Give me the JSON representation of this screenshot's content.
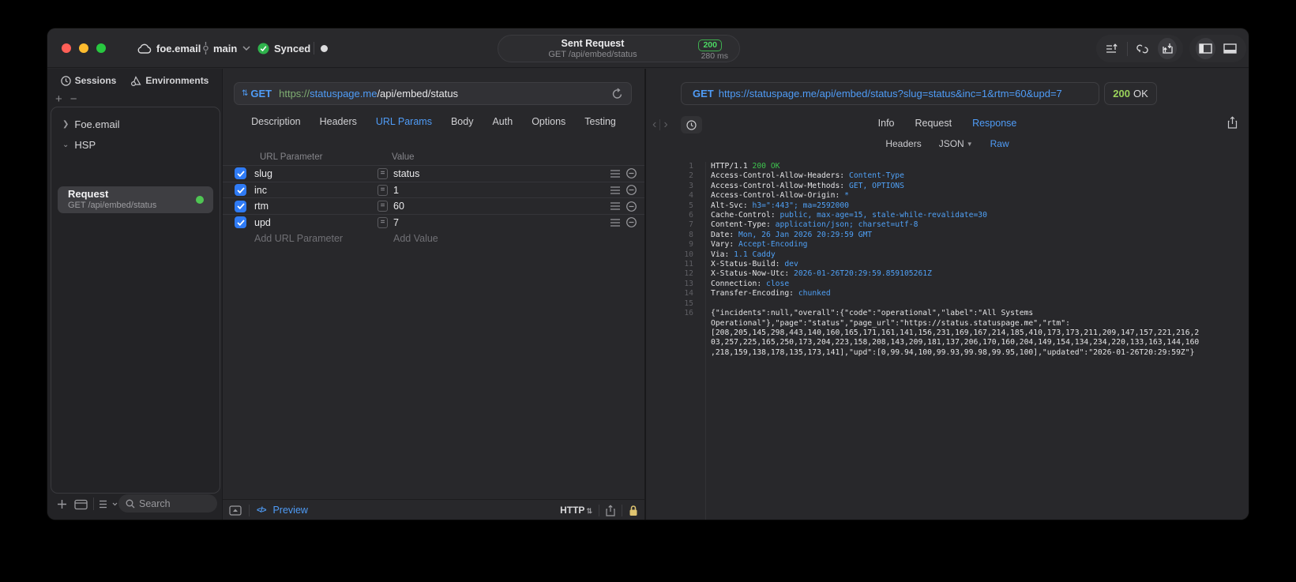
{
  "titlebar": {
    "project": "foe.email",
    "branch": "main",
    "sync_label": "Synced",
    "center": {
      "title": "Sent Request",
      "subtitle": "GET /api/embed/status",
      "status_code": "200",
      "duration": "280 ms"
    }
  },
  "sidebar": {
    "tabs": [
      {
        "label": "Sessions",
        "icon": "clock-icon"
      },
      {
        "label": "Environments",
        "icon": "environments-icon"
      }
    ],
    "tree": [
      {
        "label": "Foe.email",
        "expanded": false
      },
      {
        "label": "HSP",
        "expanded": true
      }
    ],
    "request_item": {
      "title": "Request",
      "subtitle": "GET /api/embed/status",
      "selected": true,
      "status_dot_color": "#4fc553"
    },
    "search_placeholder": "Search"
  },
  "request_editor": {
    "method": "GET",
    "method_stepper_icon": "up-down-stepper-icon",
    "url": {
      "scheme": "https://",
      "host": "statuspage.me",
      "path": "/api/embed/status"
    },
    "tabs": [
      "Description",
      "Headers",
      "URL Params",
      "Body",
      "Auth",
      "Options",
      "Testing"
    ],
    "active_tab": "URL Params",
    "params": {
      "columns": [
        "URL Parameter",
        "Value"
      ],
      "rows": [
        {
          "checked": true,
          "name": "slug",
          "value": "status"
        },
        {
          "checked": true,
          "name": "inc",
          "value": "1"
        },
        {
          "checked": true,
          "name": "rtm",
          "value": "60"
        },
        {
          "checked": true,
          "name": "upd",
          "value": "7"
        }
      ],
      "add_row": {
        "name_placeholder": "Add URL Parameter",
        "value_placeholder": "Add Value"
      }
    },
    "footer": {
      "preview": "Preview",
      "code_glyph": "</>",
      "protocol": "HTTP"
    }
  },
  "response": {
    "request_method": "GET",
    "request_url": "https://statuspage.me/api/embed/status?slug=status&inc=1&rtm=60&upd=7",
    "status_code": "200",
    "status_text": "OK",
    "tabs": [
      "Info",
      "Request",
      "Response"
    ],
    "active_tab": "Response",
    "subtabs": [
      {
        "label": "Headers"
      },
      {
        "label": "JSON",
        "chevron": true
      },
      {
        "label": "Raw",
        "active": true
      }
    ],
    "raw_lines": [
      {
        "n": "1",
        "name": "HTTP/1.1",
        "sep": " ",
        "value": "200 OK",
        "style": "g"
      },
      {
        "n": "2",
        "name": "Access-Control-Allow-Headers",
        "sep": ": ",
        "value": "Content-Type",
        "style": "b"
      },
      {
        "n": "3",
        "name": "Access-Control-Allow-Methods",
        "sep": ": ",
        "value": "GET, OPTIONS",
        "style": "b"
      },
      {
        "n": "4",
        "name": "Access-Control-Allow-Origin",
        "sep": ": ",
        "value": "*",
        "style": "b"
      },
      {
        "n": "5",
        "name": "Alt-Svc",
        "sep": ": ",
        "value": "h3=\":443\"; ma=2592000",
        "style": "b"
      },
      {
        "n": "6",
        "name": "Cache-Control",
        "sep": ": ",
        "value": "public, max-age=15, stale-while-revalidate=30",
        "style": "b"
      },
      {
        "n": "7",
        "name": "Content-Type",
        "sep": ": ",
        "value": "application/json; charset=utf-8",
        "style": "b"
      },
      {
        "n": "8",
        "name": "Date",
        "sep": ": ",
        "value": "Mon, 26 Jan 2026 20:29:59 GMT",
        "style": "b"
      },
      {
        "n": "9",
        "name": "Vary",
        "sep": ": ",
        "value": "Accept-Encoding",
        "style": "b"
      },
      {
        "n": "10",
        "name": "Via",
        "sep": ": ",
        "value": "1.1 Caddy",
        "style": "b"
      },
      {
        "n": "11",
        "name": "X-Status-Build",
        "sep": ": ",
        "value": "dev",
        "style": "b"
      },
      {
        "n": "12",
        "name": "X-Status-Now-Utc",
        "sep": ": ",
        "value": "2026-01-26T20:29:59.859105261Z",
        "style": "b"
      },
      {
        "n": "13",
        "name": "Connection",
        "sep": ": ",
        "value": "close",
        "style": "b"
      },
      {
        "n": "14",
        "name": "Transfer-Encoding",
        "sep": ": ",
        "value": "chunked",
        "style": "b"
      },
      {
        "n": "15",
        "name": "",
        "sep": "",
        "value": "",
        "style": "p"
      }
    ],
    "body_line_number": "16",
    "body": "{\"incidents\":null,\"overall\":{\"code\":\"operational\",\"label\":\"All Systems Operational\"},\"page\":\"status\",\"page_url\":\"https://status.statuspage.me\",\"rtm\":[208,205,145,298,443,140,160,165,171,161,141,156,231,169,167,214,185,410,173,173,211,209,147,157,221,216,203,257,225,165,250,173,204,223,158,208,143,209,181,137,206,170,160,204,149,154,134,234,220,133,163,144,160,218,159,138,178,135,173,141],\"upd\":[0,99.94,100,99.93,99.98,99.95,100],\"updated\":\"2026-01-26T20:29:59Z\"}"
  },
  "icons": {
    "traffic_lights": [
      "close-button",
      "minimize-button",
      "zoom-button"
    ],
    "titlebar": [
      "cloud-icon",
      "git-branch-icon",
      "chevron-down-icon",
      "synced-check-icon",
      "unsaved-dot"
    ],
    "titlebar_right": [
      "request-list-icon",
      "link-loop-icon",
      "import-export-icon",
      "left-sidebar-icon",
      "bottom-panel-icon"
    ],
    "sidebar_bottom": [
      "plus-icon",
      "new-folder-icon",
      "list-view-icon",
      "search-icon"
    ],
    "param_row": [
      "checkbox",
      "equals-icon",
      "reorder-icon",
      "remove-icon"
    ],
    "mid_footer": [
      "expand-panel-icon",
      "code-icon",
      "http-selector",
      "share-icon",
      "lock-icon"
    ],
    "response_nav": [
      "back-icon",
      "forward-icon",
      "history-clock-icon",
      "share-icon"
    ]
  }
}
